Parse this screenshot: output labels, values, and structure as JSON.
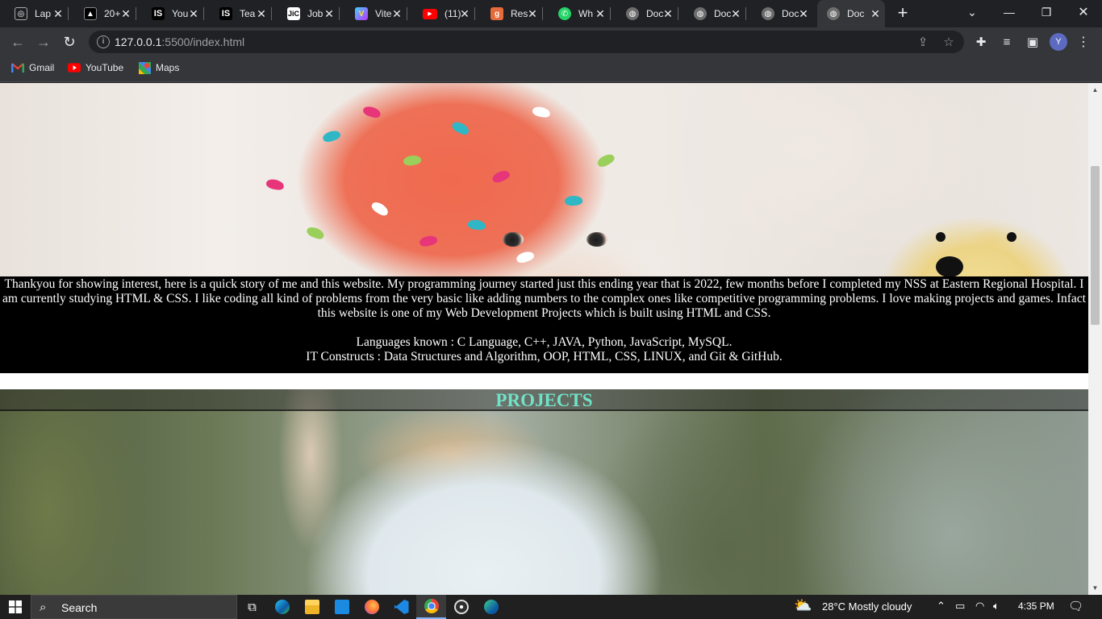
{
  "browser": {
    "tabs": [
      {
        "label": "Laptops",
        "favicon": "chatgpt-icon",
        "color": "#1e1f21",
        "glyph": "◎"
      },
      {
        "label": "20+",
        "favicon": "tab-generic-icon",
        "color": "#000000",
        "glyph": "▲"
      },
      {
        "label": "YouTube",
        "favicon": "interviewbit-icon",
        "color": "#000000",
        "glyph": "IS"
      },
      {
        "label": "Teach",
        "favicon": "interviewbit-icon",
        "color": "#000000",
        "glyph": "IS"
      },
      {
        "label": "Jobs",
        "favicon": "jio-icon",
        "color": "#ffffff",
        "glyph": "Ji"
      },
      {
        "label": "Vite",
        "favicon": "vite-icon",
        "color": "#7d5cf2",
        "glyph": "V"
      },
      {
        "label": "(11)",
        "favicon": "youtube-icon",
        "color": "#ff0000",
        "glyph": "▶"
      },
      {
        "label": "Resume",
        "favicon": "g-icon",
        "color": "#e66b3a",
        "glyph": "g"
      },
      {
        "label": "WhatsApp",
        "favicon": "whatsapp-icon",
        "color": "#25d366",
        "glyph": "✆"
      },
      {
        "label": "Document",
        "favicon": "globe-icon",
        "color": "#6e6e6e",
        "glyph": "◍"
      },
      {
        "label": "Document",
        "favicon": "globe-icon",
        "color": "#6e6e6e",
        "glyph": "◍"
      },
      {
        "label": "Document",
        "favicon": "globe-icon",
        "color": "#6e6e6e",
        "glyph": "◍"
      },
      {
        "label": "Document",
        "favicon": "globe-icon",
        "color": "#6e6e6e",
        "glyph": "◍",
        "active": true
      }
    ],
    "tab_texts": [
      "Lap",
      "20+",
      "You",
      "Tea",
      "Job",
      "Vite",
      "(11)",
      "Res",
      "Wh",
      "Doc",
      "Doc",
      "Doc",
      "Doc"
    ],
    "new_tab": "+",
    "url_host": "127.0.0.1",
    "url_path": ":5500/index.html",
    "profile_initial": "Y",
    "bookmarks": [
      {
        "label": "Gmail",
        "icon": "gmail-icon"
      },
      {
        "label": "YouTube",
        "icon": "youtube-icon"
      },
      {
        "label": "Maps",
        "icon": "maps-icon"
      }
    ]
  },
  "page": {
    "about_paragraph": "Thankyou for showing interest, here is a quick story of me and this website. My programming journey started just this ending year that is 2022, few months before I completed my NSS at Eastern Regional Hospital. I am currently studying HTML & CSS. I like coding all kind of problems from the very basic like adding numbers to the complex ones like competitive programming problems. I love making projects and games. Infact this website is one of my Web Development Projects which is built using HTML and CSS.",
    "languages_line": "Languages known : C Language, C++, JAVA, Python, JavaScript, MySQL.",
    "constructs_line": "IT Constructs : Data Structures and Algorithm, OOP, HTML, CSS, LINUX, and Git & GitHub.",
    "projects_heading": "PROJECTS",
    "projects_heading_color": "#6fe3c7"
  },
  "taskbar": {
    "search_label": "Search",
    "weather": "28°C  Mostly cloudy",
    "time": "4:35 PM",
    "apps": [
      "task-view-icon",
      "edge-icon",
      "file-explorer-icon",
      "mail-icon",
      "firefox-icon",
      "vscode-icon",
      "chrome-icon",
      "obs-icon",
      "edge-dev-icon"
    ]
  }
}
